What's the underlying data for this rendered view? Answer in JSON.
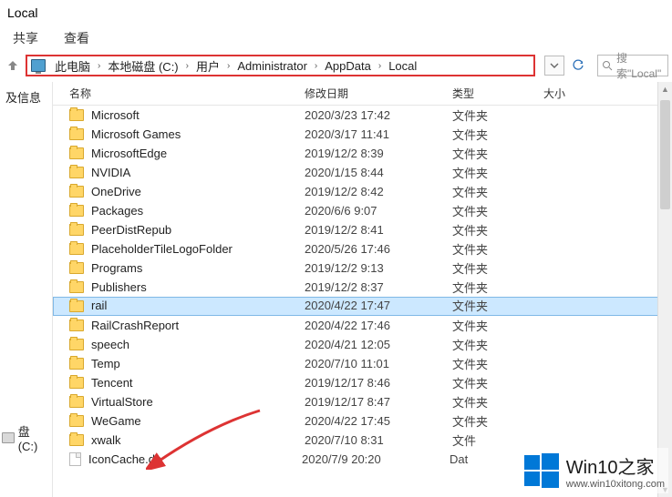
{
  "window": {
    "title": "Local"
  },
  "menu": {
    "share": "共享",
    "view": "查看"
  },
  "breadcrumb": {
    "items": [
      "此电脑",
      "本地磁盘 (C:)",
      "用户",
      "Administrator",
      "AppData",
      "Local"
    ]
  },
  "search": {
    "placeholder": "搜索\"Local\""
  },
  "sidebar": {
    "item1": "及信息",
    "drive": "盘 (C:)"
  },
  "headers": {
    "name": "名称",
    "modified": "修改日期",
    "type": "类型",
    "size": "大小"
  },
  "rows": [
    {
      "icon": "folder",
      "name": "Microsoft",
      "date": "2020/3/23 17:42",
      "type": "文件夹",
      "selected": false
    },
    {
      "icon": "folder",
      "name": "Microsoft Games",
      "date": "2020/3/17 11:41",
      "type": "文件夹",
      "selected": false
    },
    {
      "icon": "folder",
      "name": "MicrosoftEdge",
      "date": "2019/12/2 8:39",
      "type": "文件夹",
      "selected": false
    },
    {
      "icon": "folder",
      "name": "NVIDIA",
      "date": "2020/1/15 8:44",
      "type": "文件夹",
      "selected": false
    },
    {
      "icon": "folder",
      "name": "OneDrive",
      "date": "2019/12/2 8:42",
      "type": "文件夹",
      "selected": false
    },
    {
      "icon": "folder",
      "name": "Packages",
      "date": "2020/6/6 9:07",
      "type": "文件夹",
      "selected": false
    },
    {
      "icon": "folder",
      "name": "PeerDistRepub",
      "date": "2019/12/2 8:41",
      "type": "文件夹",
      "selected": false
    },
    {
      "icon": "folder",
      "name": "PlaceholderTileLogoFolder",
      "date": "2020/5/26 17:46",
      "type": "文件夹",
      "selected": false
    },
    {
      "icon": "folder",
      "name": "Programs",
      "date": "2019/12/2 9:13",
      "type": "文件夹",
      "selected": false
    },
    {
      "icon": "folder",
      "name": "Publishers",
      "date": "2019/12/2 8:37",
      "type": "文件夹",
      "selected": false
    },
    {
      "icon": "folder",
      "name": "rail",
      "date": "2020/4/22 17:47",
      "type": "文件夹",
      "selected": true
    },
    {
      "icon": "folder",
      "name": "RailCrashReport",
      "date": "2020/4/22 17:46",
      "type": "文件夹",
      "selected": false
    },
    {
      "icon": "folder",
      "name": "speech",
      "date": "2020/4/21 12:05",
      "type": "文件夹",
      "selected": false
    },
    {
      "icon": "folder",
      "name": "Temp",
      "date": "2020/7/10 11:01",
      "type": "文件夹",
      "selected": false
    },
    {
      "icon": "folder",
      "name": "Tencent",
      "date": "2019/12/17 8:46",
      "type": "文件夹",
      "selected": false
    },
    {
      "icon": "folder",
      "name": "VirtualStore",
      "date": "2019/12/17 8:47",
      "type": "文件夹",
      "selected": false
    },
    {
      "icon": "folder",
      "name": "WeGame",
      "date": "2020/4/22 17:45",
      "type": "文件夹",
      "selected": false
    },
    {
      "icon": "folder",
      "name": "xwalk",
      "date": "2020/7/10 8:31",
      "type": "文件",
      "selected": false
    },
    {
      "icon": "file",
      "name": "IconCache.db",
      "date": "2020/7/9 20:20",
      "type": "Dat",
      "selected": false
    }
  ],
  "watermark": {
    "title": "Win10之家",
    "url": "www.win10xitong.com"
  }
}
